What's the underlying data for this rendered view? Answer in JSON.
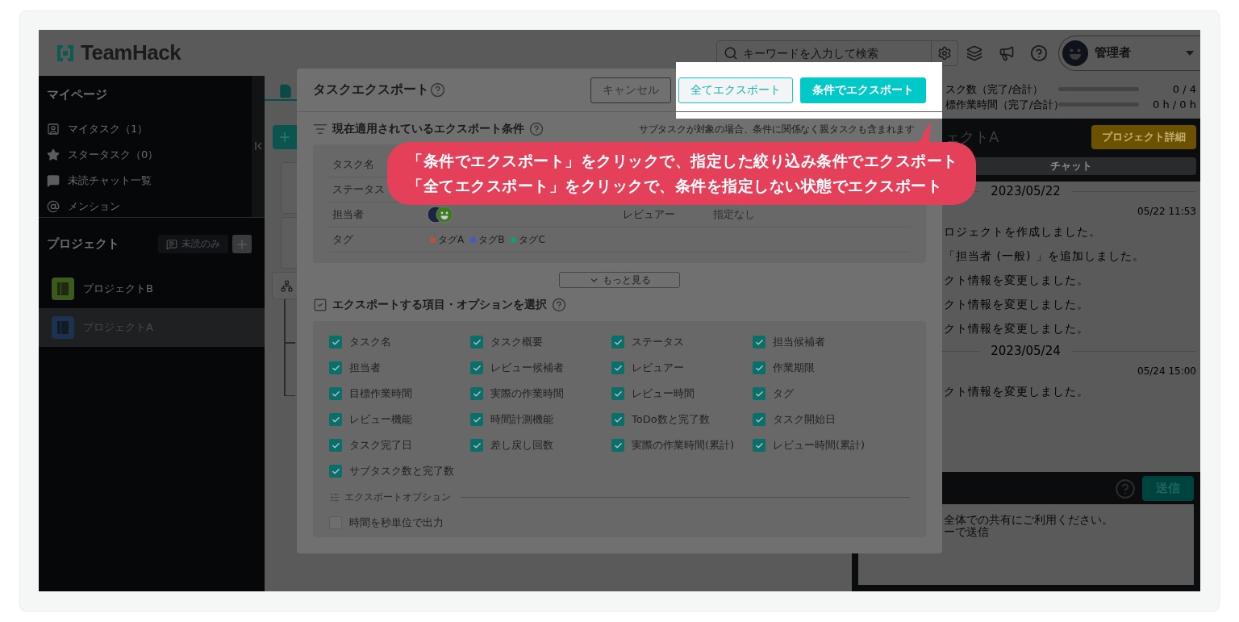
{
  "header": {
    "logo": "TeamHack",
    "search": {
      "placeholder": "キーワードを入力して検索"
    },
    "user": "管理者"
  },
  "sidebar": {
    "mypage_title": "マイページ",
    "mypage_items": [
      {
        "kind": "task",
        "label": "マイタスク（1）"
      },
      {
        "kind": "star",
        "label": "スタータスク（0）"
      },
      {
        "kind": "chat",
        "label": "未読チャット一覧"
      },
      {
        "kind": "mention",
        "label": "メンション"
      }
    ],
    "projects_title": "プロジェクト",
    "unread_filter": "未読のみ",
    "projects": [
      {
        "name": "プロジェクトB",
        "color": "#3b5a1c",
        "selected": false
      },
      {
        "name": "プロジェクトA",
        "color": "#1c324e",
        "selected": true
      }
    ]
  },
  "right_panel": {
    "stats": [
      {
        "label": "スク数（完了/合計）",
        "level": 0,
        "reading": "0 / 4"
      },
      {
        "label": "標作業時間（完了/合計）",
        "level": 0,
        "reading": "0 h / 0 h"
      }
    ],
    "project_title": "ェクトA",
    "detail_button": "プロジェクト詳細",
    "tab": "チャット",
    "log": [
      {
        "kind": "date",
        "text": "2023/05/22"
      },
      {
        "kind": "time",
        "text": "05/22 11:53"
      },
      {
        "kind": "message",
        "text": "ロジェクトを作成しました。"
      },
      {
        "kind": "message",
        "text": "「担当者 (一般) 」を追加しました。"
      },
      {
        "kind": "message",
        "text": "クト情報を変更しました。"
      },
      {
        "kind": "message",
        "text": "クト情報を変更しました。"
      },
      {
        "kind": "message",
        "text": "クト情報を変更しました。"
      },
      {
        "kind": "date",
        "text": "2023/05/24"
      },
      {
        "kind": "time",
        "text": "05/24 15:00"
      },
      {
        "kind": "message",
        "text": "クト情報を変更しました。"
      }
    ],
    "send_button": "送信",
    "composer_lines": [
      "全体での共有にご利用ください。",
      "ーで送信"
    ]
  },
  "modal": {
    "title": "タスクエクスポート",
    "buttons": [
      {
        "kind": "cancel",
        "label": "キャンセル"
      },
      {
        "kind": "all",
        "label": "全てエクスポート"
      },
      {
        "kind": "filtered",
        "label": "条件でエクスポート"
      }
    ],
    "conditions": {
      "title": "現在適用されているエクスポート条件",
      "note": "サブタスクが対象の場合、条件に関係なく親タスクも含まれます",
      "rows": [
        {
          "kind": "plain",
          "label": "タスク名"
        },
        {
          "kind": "plain",
          "label": "ステータス"
        },
        {
          "kind": "avatars",
          "label": "担当者",
          "label_2": "レビュアー",
          "value_2": "指定なし"
        },
        {
          "kind": "tags",
          "label": "タグ",
          "tags": [
            {
              "name": "タグA",
              "color": "#c0503c"
            },
            {
              "name": "タグB",
              "color": "#4a56c8"
            },
            {
              "name": "タグC",
              "color": "#1a9a6e"
            }
          ]
        }
      ]
    },
    "more_button": "もっと見る",
    "items_title": "エクスポートする項目・オプションを選択",
    "items": [
      {
        "label": "タスク名",
        "checked": true
      },
      {
        "label": "タスク概要",
        "checked": true
      },
      {
        "label": "ステータス",
        "checked": true
      },
      {
        "label": "担当候補者",
        "checked": true
      },
      {
        "label": "担当者",
        "checked": true
      },
      {
        "label": "レビュー候補者",
        "checked": true
      },
      {
        "label": "レビュアー",
        "checked": true
      },
      {
        "label": "作業期限",
        "checked": true
      },
      {
        "label": "目標作業時間",
        "checked": true
      },
      {
        "label": "実際の作業時間",
        "checked": true
      },
      {
        "label": "レビュー時間",
        "checked": true
      },
      {
        "label": "タグ",
        "checked": true
      },
      {
        "label": "レビュー機能",
        "checked": true
      },
      {
        "label": "時間計測機能",
        "checked": true
      },
      {
        "label": "ToDo数と完了数",
        "checked": true
      },
      {
        "label": "タスク開始日",
        "checked": true
      },
      {
        "label": "タスク完了日",
        "checked": true
      },
      {
        "label": "差し戻し回数",
        "checked": true
      },
      {
        "label": "実際の作業時間(累計)",
        "checked": true
      },
      {
        "label": "レビュー時間(累計)",
        "checked": true
      },
      {
        "label": "サブタスク数と完了数",
        "checked": true
      }
    ],
    "options_title": "エクスポートオプション",
    "options": [
      {
        "label": "時間を秒単位で出力",
        "checked": false
      }
    ]
  },
  "callout": {
    "lines": [
      "「条件でエクスポート」をクリックで、指定した絞り込み条件でエクスポート",
      "「全てエクスポート」をクリックで、条件を指定しない状態でエクスポート"
    ]
  }
}
